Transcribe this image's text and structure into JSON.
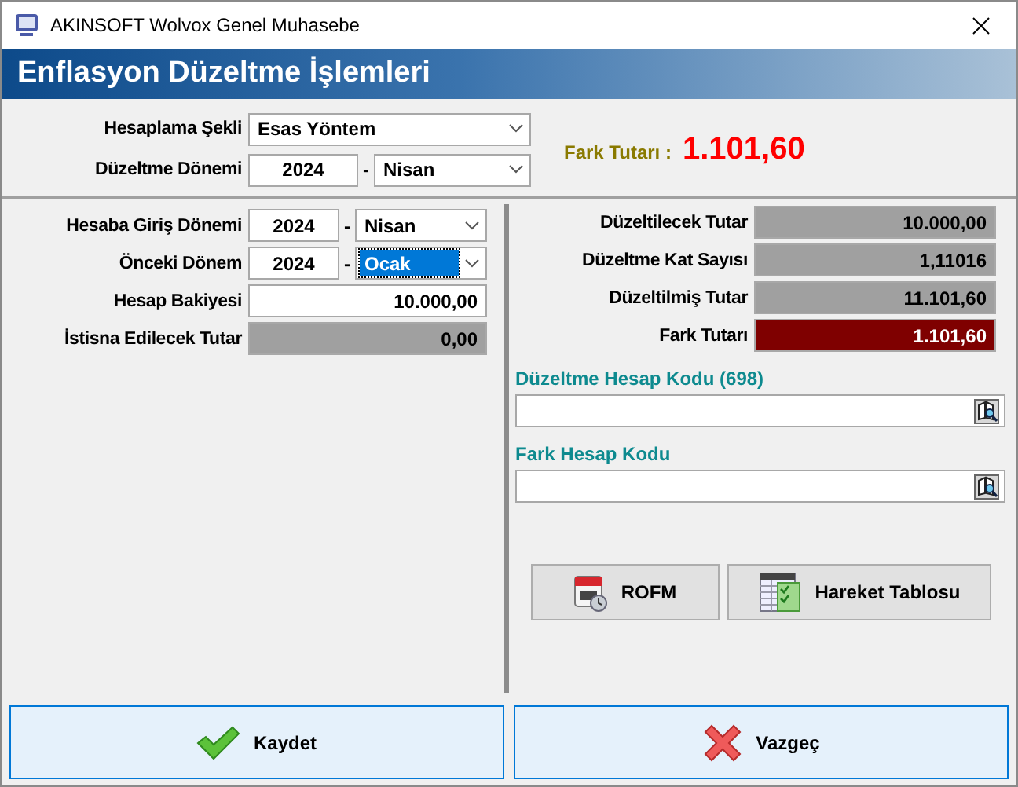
{
  "window": {
    "title": "AKINSOFT Wolvox Genel Muhasebe"
  },
  "header": {
    "title": "Enflasyon Düzeltme İşlemleri"
  },
  "top": {
    "method": {
      "label": "Hesaplama Şekli",
      "value": "Esas Yöntem"
    },
    "period": {
      "label": "Düzeltme Dönemi",
      "year": "2024",
      "separator": "-",
      "month": "Nisan"
    },
    "difference": {
      "label": "Fark Tutarı :",
      "value": "1.101,60"
    }
  },
  "left": {
    "rows": [
      {
        "kind": "period",
        "label": "Hesaba Giriş Dönemi",
        "year": "2024",
        "separator": "-",
        "month": "Nisan",
        "selected": false
      },
      {
        "kind": "period",
        "label": "Önceki Dönem",
        "year": "2024",
        "separator": "-",
        "month": "Ocak",
        "selected": true
      },
      {
        "kind": "input",
        "label": "Hesap Bakiyesi",
        "value": "10.000,00"
      },
      {
        "kind": "readonly",
        "label": "İstisna Edilecek Tutar",
        "value": "0,00"
      }
    ]
  },
  "right": {
    "rows": [
      {
        "kind": "readonly",
        "label": "Düzeltilecek Tutar",
        "value": "10.000,00"
      },
      {
        "kind": "readonly",
        "label": "Düzeltme Kat Sayısı",
        "value": "1,11016"
      },
      {
        "kind": "readonly",
        "label": "Düzeltilmiş Tutar",
        "value": "11.101,60"
      },
      {
        "kind": "alert",
        "label": "Fark Tutarı",
        "value": "1.101,60"
      }
    ],
    "lookups": [
      {
        "label": "Düzeltme Hesap Kodu (698)"
      },
      {
        "label": "Fark Hesap Kodu"
      }
    ],
    "actions": [
      {
        "kind": "calendar",
        "label": "ROFM"
      },
      {
        "kind": "table",
        "label": "Hareket Tablosu"
      }
    ]
  },
  "footer": {
    "buttons": [
      {
        "kind": "save",
        "label": "Kaydet"
      },
      {
        "kind": "cancel",
        "label": "Vazgeç"
      }
    ]
  }
}
